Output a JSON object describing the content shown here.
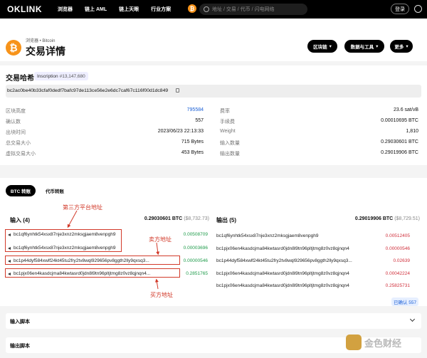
{
  "brand": {
    "logo": "OKLINK"
  },
  "nav": {
    "items": [
      "浏览器",
      "链上 AML",
      "链上天眼",
      "行业方案"
    ]
  },
  "search": {
    "placeholder": "地址 / 交易 / 代币 / 闪电网络"
  },
  "header": {
    "login": "登录",
    "breadcrumb": "浏览器 • Bitcoin",
    "title": "交易详情",
    "buttons": [
      "区块链",
      "数据与工具",
      "更多"
    ]
  },
  "tx": {
    "hash_label": "交易哈希",
    "inscription_label": "Inscription",
    "inscription_num": "#13,147,680",
    "hash": "bc2ac0be40b33cfaf0dedf7bafc97de113ce56e2e6dc7caf67c116f00d1dc849"
  },
  "details_left": [
    {
      "label": "区块高度",
      "value": "795584"
    },
    {
      "label": "确认数",
      "value": "557"
    },
    {
      "label": "出块时间",
      "value": "2023/06/23 22:13:33"
    },
    {
      "label": "总交易大小",
      "value": "715 Bytes"
    },
    {
      "label": "虚拟交易大小",
      "value": "453 Bytes"
    }
  ],
  "details_right": [
    {
      "label": "费率",
      "value": "23.6 sat/vB"
    },
    {
      "label": "手续费",
      "value": "0.00010695 BTC"
    },
    {
      "label": "Weight",
      "value": "1,810"
    },
    {
      "label": "输入数量",
      "value": "0.29030601 BTC"
    },
    {
      "label": "输出数量",
      "value": "0.29019906 BTC"
    }
  ],
  "tabs": {
    "active": "BTC 转账",
    "other": "代币转账"
  },
  "inputs": {
    "title": "输入 (4)",
    "total": "0.29030601 BTC",
    "total_usd": "($8,732.73)",
    "rows": [
      {
        "addr": "bc1qf6ynhtk54xsx87nje3xnz2mksgjaem8venpgh9",
        "amount": "0.00508709"
      },
      {
        "addr": "bc1qf6ynhtk54xsx87nje3xnz2mksgjaem8venpgh9",
        "amount": "0.00003696"
      },
      {
        "addr": "bc1p44dyf584xwlf24kt45tu2fry2tv8wql929656pv8ggth2lly9qxsq3...",
        "amount": "0.00000546"
      },
      {
        "addr": "bc1pjx06en4kasdcjma84kwtasrd0jdn8l9tn96pltjtmg8z0vz8qjnqn4...",
        "amount": "0.2851765"
      }
    ]
  },
  "outputs": {
    "title": "输出 (5)",
    "total": "0.29019906 BTC",
    "total_usd": "($8,729.51)",
    "rows": [
      {
        "addr": "bc1qf6ynhtk54xsx87nje3xnz2mksgjaem8venpgh9",
        "amount": "0.00512405"
      },
      {
        "addr": "bc1pjx06en4kasdcjma84kwtasrd0jdn8l9tn96pltjtmg8z0vz8qjnqn4",
        "amount": "0.00000546"
      },
      {
        "addr": "bc1p44dyf584xwlf24kt45tu2fry2tv8wql929656pv8ggth2lly9qxsq3...",
        "amount": "0.02639"
      },
      {
        "addr": "bc1pjx06en4kasdcjma84kwtasrd0jdn8l9tn96pltjtmg8z0vz8qjnqn4",
        "amount": "0.00042224"
      },
      {
        "addr": "bc1pjx06en4kasdcjma84kwtasrd0jdn8l9tn96pltjtmg8z0vz8qjnqn4",
        "amount": "0.25825731"
      }
    ],
    "confirmed": "已确认 557"
  },
  "annotations": {
    "platform": "第三方平台地址",
    "seller": "卖方地址",
    "buyer": "买方地址"
  },
  "panels": {
    "input_script": "输入脚本",
    "output_script": "输出脚本"
  },
  "watermark": {
    "text": "金色财经"
  },
  "colors": {
    "accent_btc": "#f7931a",
    "annotation_red": "#d23a2a",
    "positive": "#1e9b4a",
    "negative": "#d0303c"
  }
}
